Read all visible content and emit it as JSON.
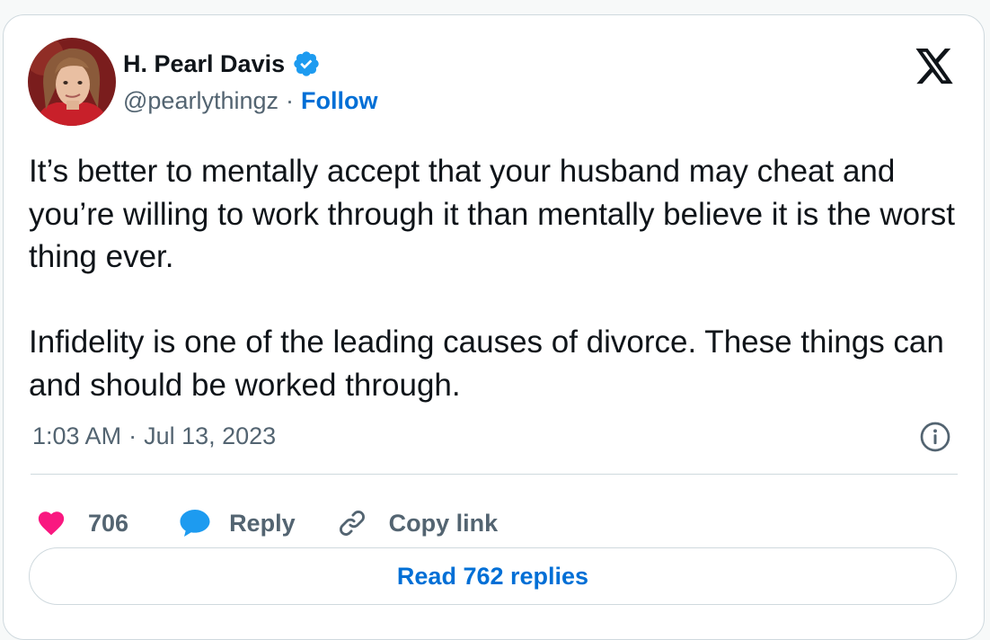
{
  "author": {
    "name": "H. Pearl Davis",
    "handle": "@pearlythingz",
    "separator": "·",
    "follow_label": "Follow",
    "verified": true
  },
  "tweet": {
    "paragraphs": [
      "It’s better to mentally accept that your husband may cheat and you’re willing to work through it than mentally believe it is the worst thing ever.",
      "Infidelity is one of the leading causes of divorce. These things can and should be worked through."
    ],
    "time": "1:03 AM",
    "separator": "·",
    "date": "Jul 13, 2023"
  },
  "actions": {
    "like_count": "706",
    "reply_label": "Reply",
    "copy_label": "Copy link"
  },
  "read_replies_label": "Read 762 replies",
  "icons": {
    "verified": "verified-badge-icon",
    "logo": "x-logo-icon",
    "info": "info-icon",
    "like": "heart-icon",
    "reply": "speech-bubble-icon",
    "copy": "link-icon"
  },
  "colors": {
    "accent_blue": "#006fd6",
    "verified_blue": "#1d9bf0",
    "heart_pink": "#f91880",
    "secondary_text": "#536471",
    "border": "#cfd9de"
  }
}
